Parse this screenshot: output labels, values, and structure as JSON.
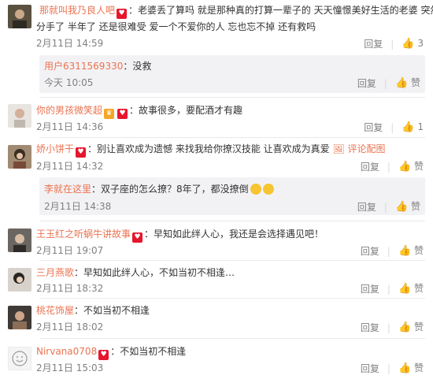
{
  "comments": [
    {
      "user": "那就叫我乃良人吧",
      "text1": "：老婆丢了算吗 就是那种真的打算一辈子的  天天憧憬美好生活的老婆 突然",
      "text2": "分手了 半年了  还是很难受 爱一个不爱你的人 忘也忘不掉  还有救吗",
      "time": "2月11日 14:59",
      "reply": "回复",
      "likes": "3",
      "sub": {
        "user": "用户6311569330",
        "text": "：没救",
        "time": "今天 10:05",
        "reply": "回复",
        "like": "赞"
      }
    },
    {
      "user": "你的男孩微笑超",
      "text1": "：故事很多，要配酒才有趣",
      "time": "2月11日 14:36",
      "reply": "回复",
      "likes": "1"
    },
    {
      "user": "娇小饼干",
      "text1": "：别让喜欢成为遗憾  来找我给你撩汉技能 让喜欢成为真爱",
      "pic": "评论配图",
      "time": "2月11日 14:32",
      "reply": "回复",
      "like": "赞",
      "sub": {
        "user": "李就在这里",
        "text": "：双子座的怎么撩？8年了，都没撩倒",
        "time": "2月11日 14:38",
        "reply": "回复",
        "like": "赞"
      }
    },
    {
      "user": "王玉红之听蜗牛讲故事",
      "text1": "：早知如此绊人心，我还是会选择遇见吧！",
      "time": "2月11日 19:07",
      "reply": "回复",
      "like": "赞"
    },
    {
      "user": "三月燕歌",
      "text1": "：早知如此绊人心，不如当初不相逢…",
      "time": "2月11日 18:32",
      "reply": "回复",
      "like": "赞"
    },
    {
      "user": "桃花饰屋",
      "text1": "：不如当初不相逢",
      "time": "2月11日 18:02",
      "reply": "回复",
      "like": "赞"
    },
    {
      "user": "Nirvana0708",
      "text1": "：不如当初不相逢",
      "time": "2月11日 15:03",
      "reply": "回复",
      "like": "赞"
    }
  ]
}
